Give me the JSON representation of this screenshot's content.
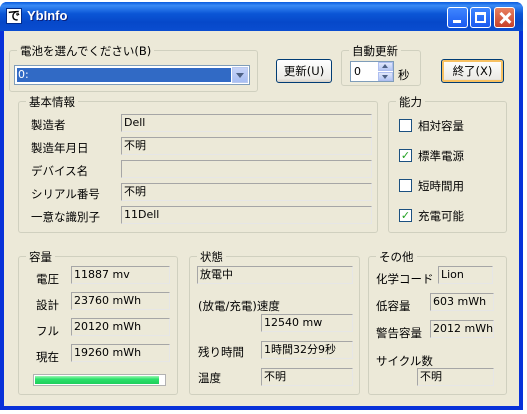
{
  "window": {
    "title": "YbInfo",
    "icon_glyph": "で"
  },
  "battery_select": {
    "label": "電池を選んでください(B)",
    "selected": "0:"
  },
  "refresh_button": {
    "label": "更新(U)"
  },
  "auto_refresh": {
    "label": "自動更新",
    "value": "0",
    "unit": "秒"
  },
  "exit_button": {
    "label": "終了(X)"
  },
  "basic_info": {
    "title": "基本情報",
    "rows": [
      {
        "label": "製造者",
        "value": "Dell"
      },
      {
        "label": "製造年月日",
        "value": "不明"
      },
      {
        "label": "デバイス名",
        "value": ""
      },
      {
        "label": "シリアル番号",
        "value": "不明"
      },
      {
        "label": "一意な識別子",
        "value": "11Dell"
      }
    ]
  },
  "capabilities": {
    "title": "能力",
    "items": [
      {
        "label": "相対容量",
        "checked": false,
        "mark": ""
      },
      {
        "label": "標準電源",
        "checked": true,
        "mark": "✓"
      },
      {
        "label": "短時間用",
        "checked": false,
        "mark": ""
      },
      {
        "label": "充電可能",
        "checked": true,
        "mark": "✓"
      }
    ]
  },
  "capacity": {
    "title": "容量",
    "rows": [
      {
        "label": "電圧",
        "value": "11887 mv"
      },
      {
        "label": "設計",
        "value": "23760 mWh"
      },
      {
        "label": "フル",
        "value": "20120 mWh"
      },
      {
        "label": "現在",
        "value": "19260 mWh"
      }
    ],
    "charge_fraction": 0.96
  },
  "status": {
    "title": "状態",
    "state": "放電中",
    "rate_label": "(放電/充電)速度",
    "rate_value": "12540 mw",
    "remaining_label": "残り時間",
    "remaining_value": "1時間32分9秒",
    "temp_label": "温度",
    "temp_value": "不明"
  },
  "other": {
    "title": "その他",
    "chemistry_label": "化学コード",
    "chemistry_value": "Lion",
    "low_label": "低容量",
    "low_value": "603 mWh",
    "warning_label": "警告容量",
    "warning_value": "2012 mWh",
    "cycle_label": "サイクル数",
    "cycle_value": "不明"
  }
}
